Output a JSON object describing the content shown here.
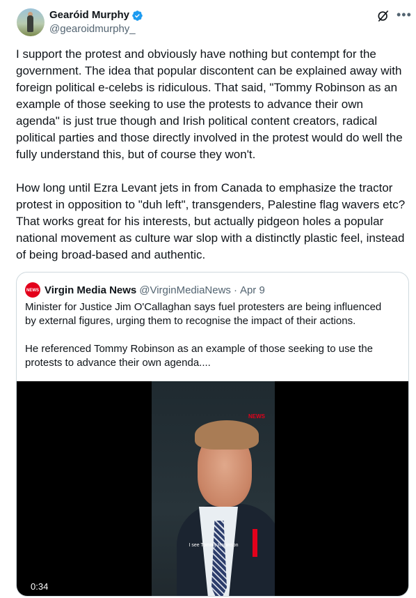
{
  "author": {
    "display_name": "Gearóid Murphy",
    "handle": "@gearoidmurphy_"
  },
  "tweet_text": "I support the protest and obviously have nothing but contempt for the government. The idea that popular discontent can be explained away with foreign political e-celebs is ridiculous. That said, \"Tommy Robinson as an example of those seeking to use the protests to advance their own agenda\" is just true though and Irish political content creators, radical political parties and those directly involved in the protest would do well the fully understand this, but of course they won't.\n\nHow long until Ezra Levant jets in from Canada to emphasize the tractor protest in opposition to \"duh left\", transgenders, Palestine flag wavers etc? That works great for his interests, but actually pidgeon holes a popular national movement as culture war slop with a distinctly plastic feel, instead of being broad-based and authentic.",
  "quoted": {
    "display_name": "Virgin Media News",
    "handle": "@VirginMediaNews",
    "separator": "·",
    "date": "Apr 9",
    "logo_text": "NEWS",
    "text": "Minister for Justice Jim O'Callaghan says fuel protesters are being influenced by external figures, urging them to recognise the impact of their actions.\n\nHe referenced Tommy Robinson as an example of those seeking to use the protests to advance their own agenda....",
    "video": {
      "duration": "0:34",
      "watermark": "NEWS",
      "caption": "I see Tommy Robinson"
    }
  },
  "icons": {
    "verified": "verified-badge-icon",
    "grok": "grok-icon",
    "more": "more-options-icon"
  },
  "colors": {
    "verified": "#1d9bf0",
    "brand_red": "#e3001b",
    "secondary_text": "#536471"
  }
}
